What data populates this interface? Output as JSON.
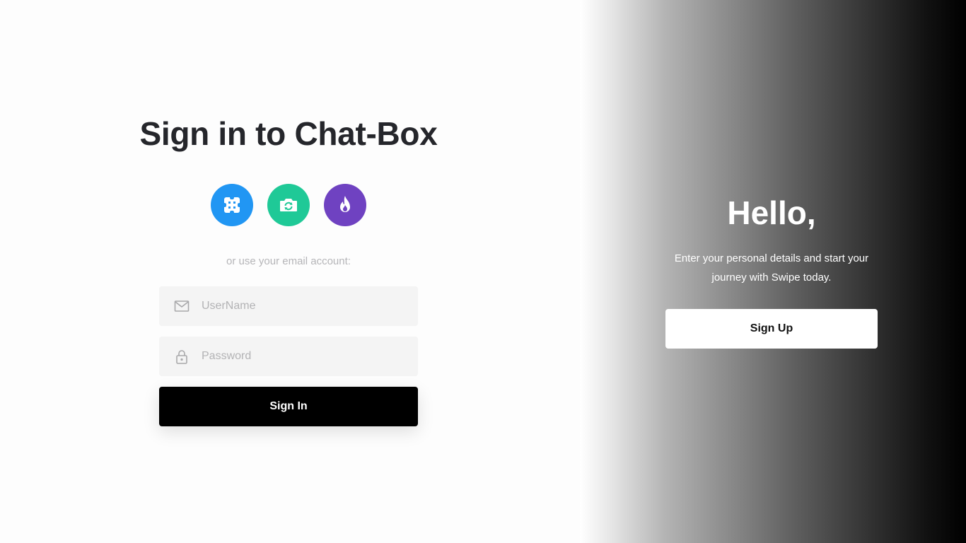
{
  "signin": {
    "title": "Sign in to Chat-Box",
    "socials": [
      {
        "icon": "puzzle-icon",
        "color": "#2196f3"
      },
      {
        "icon": "camera-refresh-icon",
        "color": "#1fc997"
      },
      {
        "icon": "flame-icon",
        "color": "#6f42c1"
      }
    ],
    "hint": "or use your email account:",
    "username": {
      "placeholder": "UserName",
      "value": "",
      "icon": "mail-icon"
    },
    "password": {
      "placeholder": "Password",
      "value": "",
      "icon": "lock-icon"
    },
    "button_label": "Sign In"
  },
  "signup_panel": {
    "heading": "Hello,",
    "text": "Enter your personal details and start your journey with Swipe today.",
    "button_label": "Sign Up"
  },
  "colors": {
    "primary_button": "#000000",
    "field_background": "#f4f4f4",
    "title": "#25262b"
  }
}
